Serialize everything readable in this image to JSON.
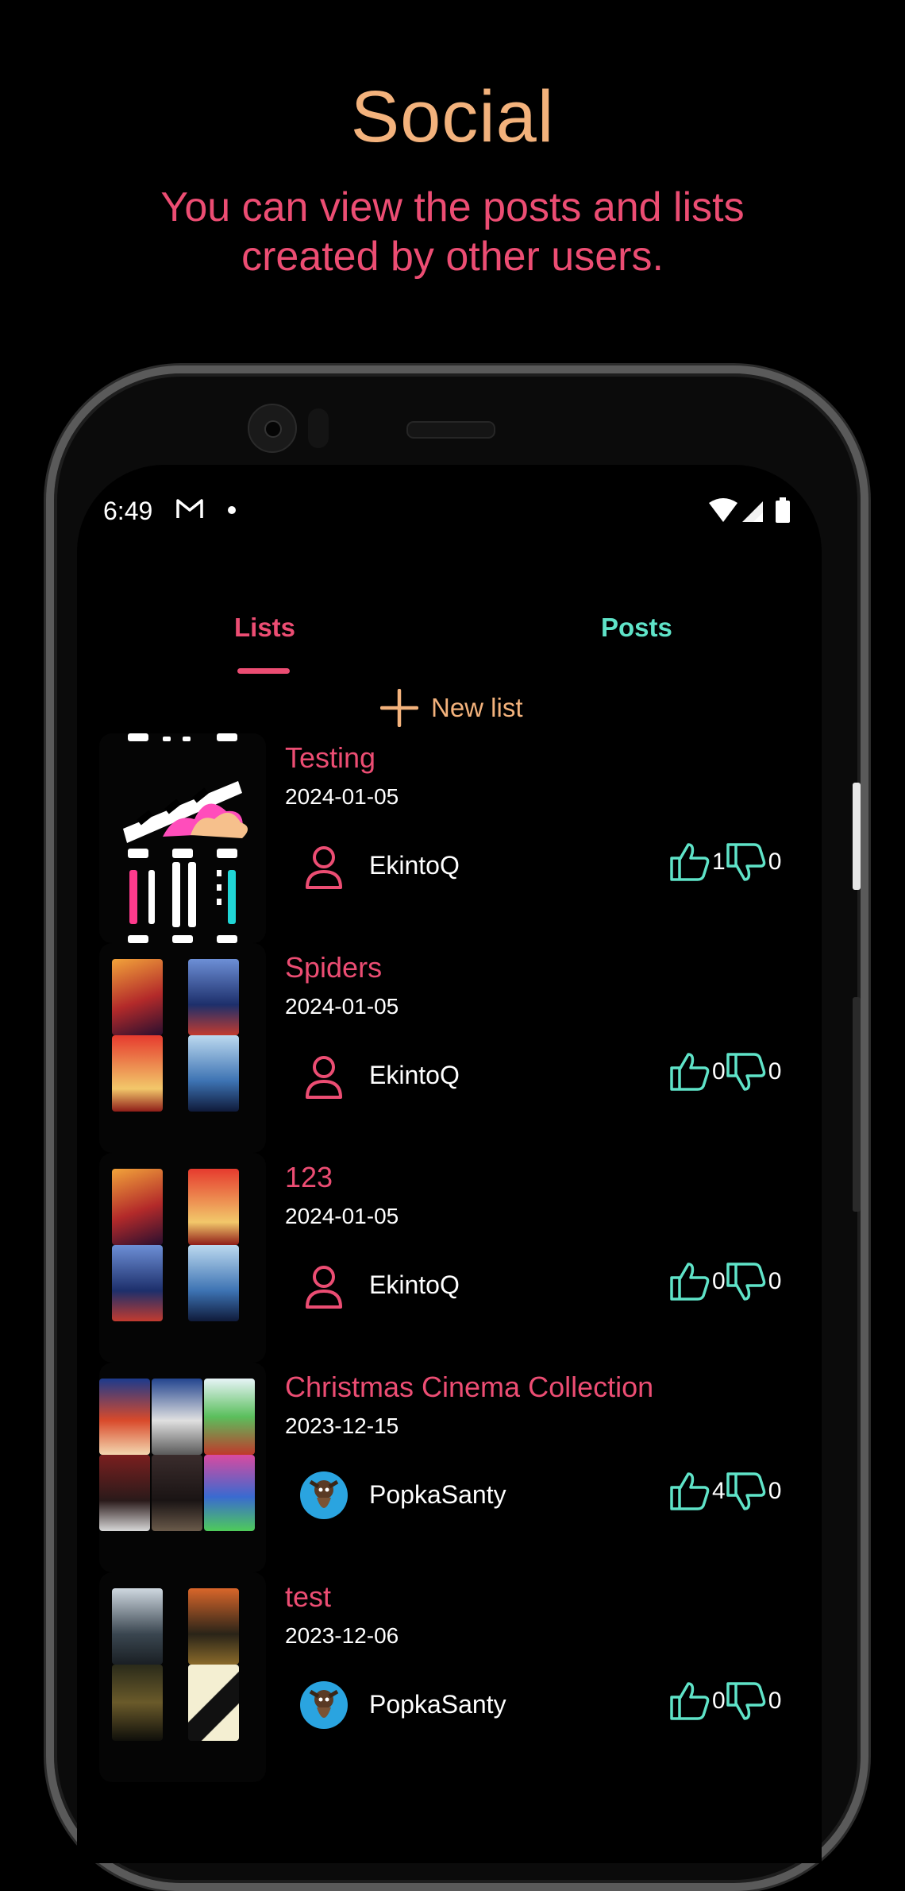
{
  "promo": {
    "title": "Social",
    "subtitle": "You can view the posts and lists created by other users."
  },
  "status_bar": {
    "time": "6:49",
    "icons": [
      "gmail-icon",
      "notification-dot-icon",
      "wifi-icon",
      "signal-icon",
      "battery-icon"
    ]
  },
  "tabs": [
    {
      "label": "Lists",
      "active": true
    },
    {
      "label": "Posts",
      "active": false
    }
  ],
  "new_list": {
    "label": "New list"
  },
  "lists": [
    {
      "title": "Testing",
      "date": "2024-01-05",
      "user": "EkintoQ",
      "likes": "1",
      "dislikes": "0",
      "avatar": "person-outline-icon"
    },
    {
      "title": "Spiders",
      "date": "2024-01-05",
      "user": "EkintoQ",
      "likes": "0",
      "dislikes": "0",
      "avatar": "person-outline-icon"
    },
    {
      "title": "123",
      "date": "2024-01-05",
      "user": "EkintoQ",
      "likes": "0",
      "dislikes": "0",
      "avatar": "person-outline-icon"
    },
    {
      "title": "Christmas Cinema Collection",
      "date": "2023-12-15",
      "user": "PopkaSanty",
      "likes": "4",
      "dislikes": "0",
      "avatar": "user-photo-avatar"
    },
    {
      "title": "test",
      "date": "2023-12-06",
      "user": "PopkaSanty",
      "likes": "0",
      "dislikes": "0",
      "avatar": "user-photo-avatar"
    }
  ],
  "colors": {
    "accent_pink": "#ec4d73",
    "accent_orange": "#f3b27c",
    "accent_teal": "#5fe3c8",
    "background": "#000000"
  }
}
